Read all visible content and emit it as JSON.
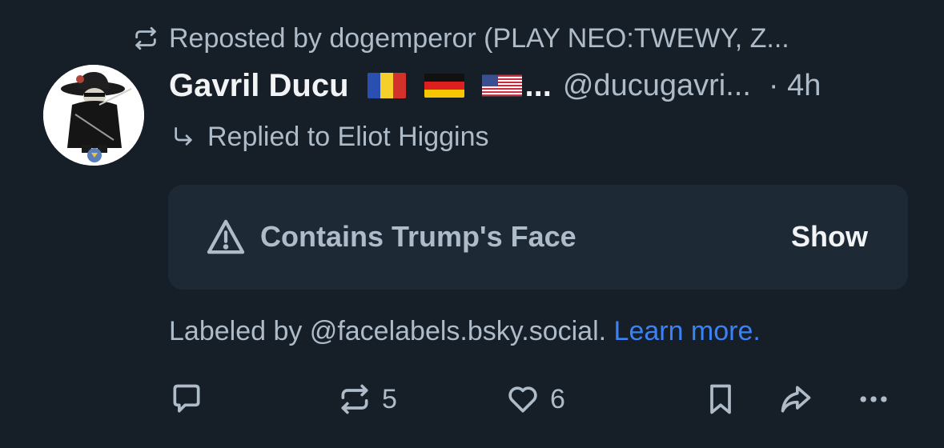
{
  "repost": {
    "icon": "repost-icon",
    "text": "Reposted by dogemperor (PLAY NEO:TWEWY, Z..."
  },
  "author": {
    "display_name": "Gavril Ducu",
    "flags": [
      "romania-flag",
      "germany-flag",
      "usa-flag"
    ],
    "name_ellipsis": "...",
    "handle": "@ducugavri...",
    "time": "· 4h"
  },
  "reply": {
    "icon": "reply-arrow-icon",
    "text": "Replied to Eliot Higgins"
  },
  "content_label": {
    "icon": "warning-icon",
    "text": "Contains Trump's Face",
    "show_label": "Show"
  },
  "labeled_by": {
    "text": "Labeled by @facelabels.bsky.social.",
    "link": "Learn more."
  },
  "actions": {
    "reply_count": "",
    "repost_count": "5",
    "like_count": "6"
  },
  "colors": {
    "background": "#161e27",
    "label_box": "#1e2936",
    "muted_text": "#aebbc9",
    "link": "#3b82f6"
  }
}
